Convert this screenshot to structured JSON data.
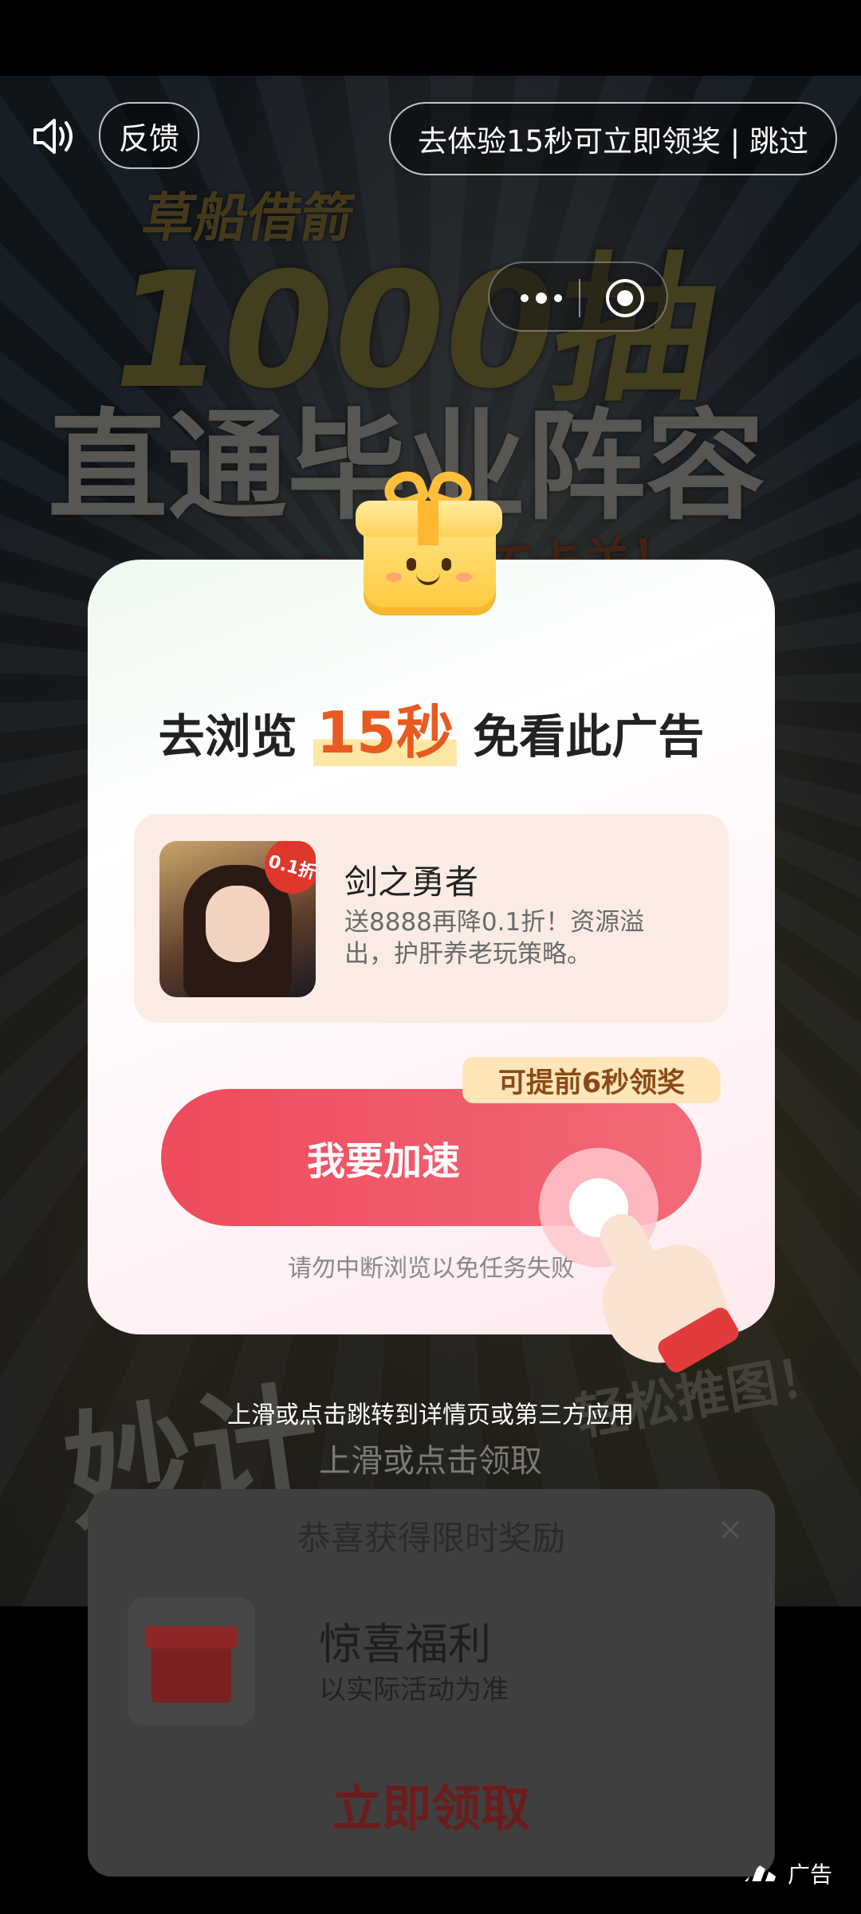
{
  "top_bar": {
    "feedback_label": "反馈",
    "skip_label": "去体验15秒可立即领奖 | 跳过"
  },
  "background": {
    "line1": "草船借箭",
    "line2": "1000抽",
    "line3": "直通毕业阵容",
    "line4": "5分钟速通，不肝不卡关！",
    "bottom_left": "妙计",
    "bottom_right": "轻松推图！"
  },
  "modal": {
    "headline_prefix": "去浏览",
    "headline_highlight": "15秒",
    "headline_suffix": "免看此广告",
    "app": {
      "badge": "0.1折",
      "name": "剑之勇者",
      "description": "送8888再降0.1折！资源溢出，护肝养老玩策略。"
    },
    "accel_tag": "可提前6秒领奖",
    "accel_button": "我要加速",
    "warning": "请勿中断浏览以免任务失败"
  },
  "hints": {
    "hint1": "上滑或点击跳转到详情页或第三方应用",
    "hint2": "上滑或点击领取"
  },
  "reward": {
    "title": "恭喜获得限时奖励",
    "close": "×",
    "name": "惊喜福利",
    "subtitle": "以实际活动为准",
    "button": "立即领取"
  },
  "ad_mark": "广告"
}
